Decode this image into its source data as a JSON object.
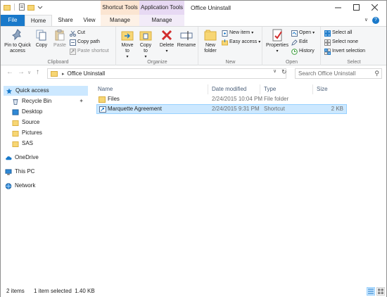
{
  "window": {
    "title": "Office Uninstall",
    "context_tabs": [
      "Shortcut Tools",
      "Application Tools"
    ],
    "controls": [
      "minimize",
      "maximize",
      "close"
    ]
  },
  "tabs": [
    "File",
    "Home",
    "Share",
    "View",
    "Manage",
    "Manage"
  ],
  "ribbon": {
    "clipboard": {
      "label": "Clipboard",
      "pin": "Pin to Quick access",
      "copy": "Copy",
      "paste": "Paste",
      "cut": "Cut",
      "copy_path": "Copy path",
      "paste_shortcut": "Paste shortcut"
    },
    "organize": {
      "label": "Organize",
      "move_to": "Move to",
      "copy_to": "Copy to",
      "delete": "Delete",
      "rename": "Rename"
    },
    "new": {
      "label": "New",
      "new_folder": "New folder",
      "new_item": "New item",
      "easy_access": "Easy access"
    },
    "open": {
      "label": "Open",
      "properties": "Properties",
      "open": "Open",
      "edit": "Edit",
      "history": "History"
    },
    "select": {
      "label": "Select",
      "select_all": "Select all",
      "select_none": "Select none",
      "invert": "Invert selection"
    }
  },
  "address": {
    "path": "Office Uninstall",
    "search_placeholder": "Search Office Uninstall"
  },
  "nav": {
    "quick_access": "Quick access",
    "items": [
      "Recycle Bin",
      "Desktop",
      "Source",
      "Pictures",
      "SAS"
    ],
    "onedrive": "OneDrive",
    "this_pc": "This PC",
    "network": "Network"
  },
  "columns": [
    "Name",
    "Date modified",
    "Type",
    "Size"
  ],
  "files": [
    {
      "name": "Files",
      "date": "2/24/2015 10:04 PM",
      "type": "File folder",
      "size": ""
    },
    {
      "name": "Marquette Agreement",
      "date": "2/24/2015 9:31 PM",
      "type": "Shortcut",
      "size": "2 KB"
    }
  ],
  "status": {
    "count": "2 items",
    "selection": "1 item selected  1.40 KB"
  },
  "colors": {
    "accent": "#1979ca",
    "selection": "#cce8ff",
    "shortcut_tools": "#fbe5d2",
    "application_tools": "#e7d9f3"
  }
}
